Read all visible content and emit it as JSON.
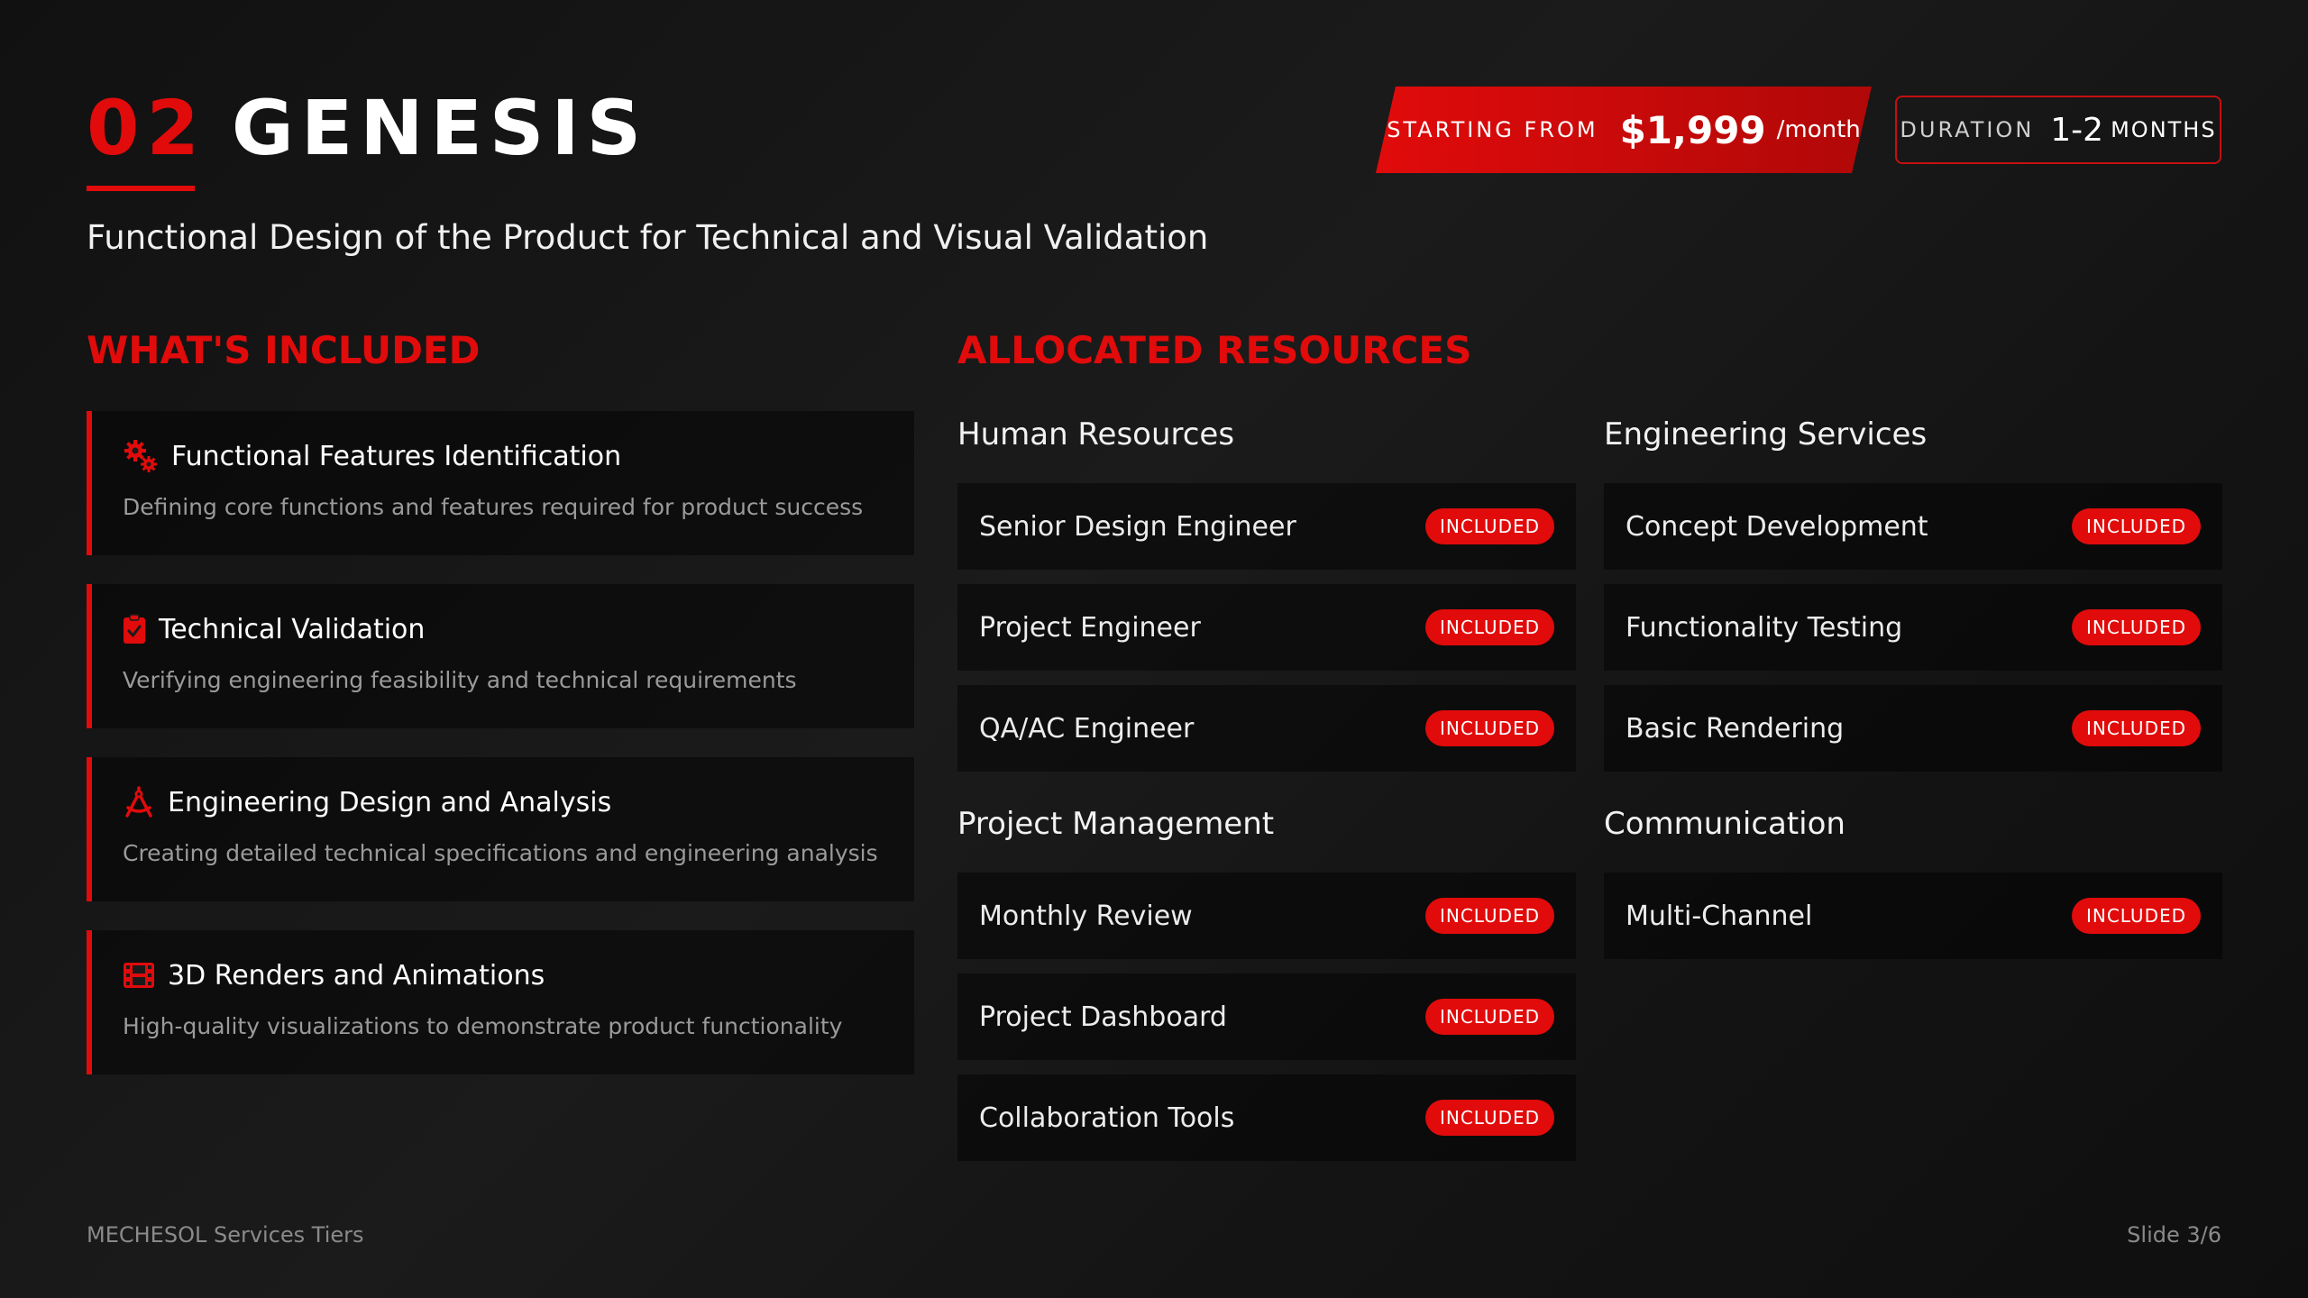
{
  "header": {
    "number": "02",
    "name": "GENESIS",
    "subtitle": "Functional Design of the Product for Technical and Visual Validation",
    "price_label": "STARTING FROM",
    "price_amount": "$1,999",
    "price_period": "/month",
    "duration_label": "DURATION",
    "duration_value": "1-2",
    "duration_unit": "MONTHS"
  },
  "included": {
    "title": "WHAT'S INCLUDED",
    "items": [
      {
        "icon": "gears-icon",
        "title": "Functional Features Identification",
        "desc": "Defining core functions and features required for product success"
      },
      {
        "icon": "clipboard-check-icon",
        "title": "Technical Validation",
        "desc": "Verifying engineering feasibility and technical requirements"
      },
      {
        "icon": "compass-drafting-icon",
        "title": "Engineering Design and Analysis",
        "desc": "Creating detailed technical specifications and engineering analysis"
      },
      {
        "icon": "film-icon",
        "title": "3D Renders and Animations",
        "desc": "High-quality visualizations to demonstrate product functionality"
      }
    ]
  },
  "resources": {
    "title": "ALLOCATED RESOURCES",
    "badge": "INCLUDED",
    "human": {
      "title": "Human Resources",
      "items": [
        "Senior Design Engineer",
        "Project Engineer",
        "QA/AC Engineer"
      ]
    },
    "engineering": {
      "title": "Engineering Services",
      "items": [
        "Concept Development",
        "Functionality Testing",
        "Basic Rendering"
      ]
    },
    "management": {
      "title": "Project Management",
      "items": [
        "Monthly Review",
        "Project Dashboard",
        "Collaboration Tools"
      ]
    },
    "communication": {
      "title": "Communication",
      "items": [
        "Multi-Channel"
      ]
    }
  },
  "footer": {
    "left": "MECHESOL Services Tiers",
    "right": "Slide 3/6"
  },
  "colors": {
    "accent": "#e10b0b",
    "background": "#151515"
  }
}
